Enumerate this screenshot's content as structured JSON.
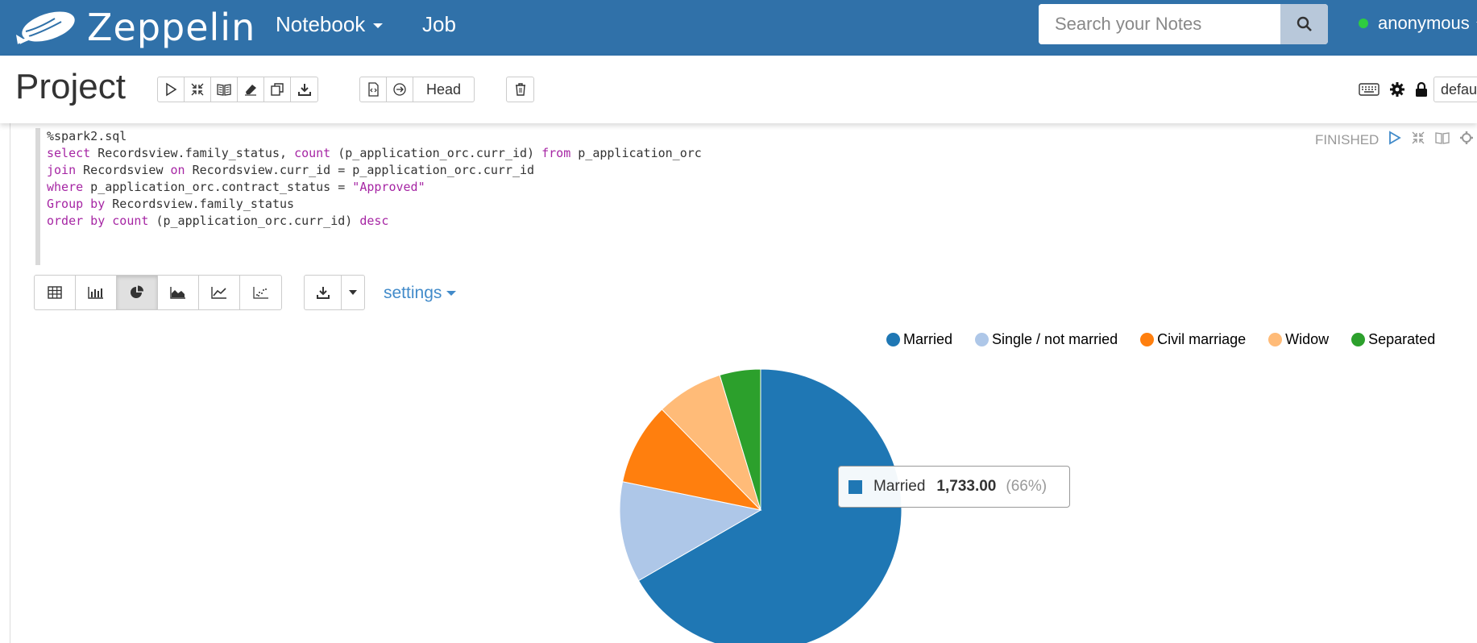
{
  "navbar": {
    "brand": "Zeppelin",
    "notebook_label": "Notebook",
    "job_label": "Job",
    "search_placeholder": "Search your Notes",
    "user": "anonymous"
  },
  "note": {
    "title": "Project",
    "head_label": "Head",
    "interpreter_select": "defau"
  },
  "paragraph": {
    "status": "FINISHED",
    "code_lines": [
      "%spark2.sql",
      "select Recordsview.family_status, count (p_application_orc.curr_id) from p_application_orc",
      "join Recordsview on Recordsview.curr_id = p_application_orc.curr_id",
      "where p_application_orc.contract_status = \"Approved\"",
      "Group by Recordsview.family_status",
      "order by count (p_application_orc.curr_id) desc"
    ],
    "settings_label": "settings",
    "active_viz": "pie"
  },
  "chart_data": {
    "type": "pie",
    "categories": [
      "Married",
      "Single / not married",
      "Civil marriage",
      "Widow",
      "Separated"
    ],
    "values": [
      1733,
      301,
      245,
      199,
      122
    ],
    "colors": [
      "#1f77b4",
      "#aec7e8",
      "#ff7f0e",
      "#ffbb78",
      "#2ca02c"
    ],
    "legend_position": "top-right"
  },
  "tooltip": {
    "label": "Married",
    "value": "1,733.00",
    "percent": "(66%)"
  }
}
